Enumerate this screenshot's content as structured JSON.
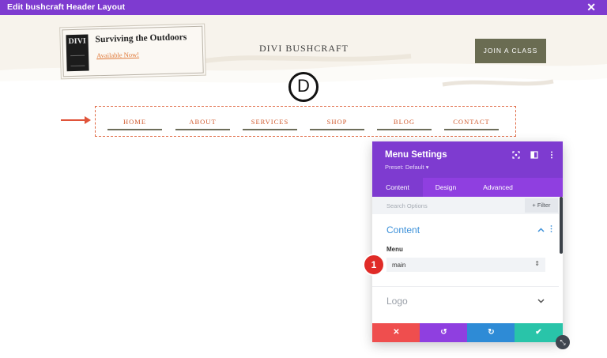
{
  "window": {
    "title": "Edit bushcraft Header Layout",
    "close_icon": "close-icon"
  },
  "header": {
    "card_title": "Surviving the Outdoors",
    "card_link": "Available Now!",
    "book_label": "DIVI",
    "brand": "DIVI BUSHCRAFT",
    "cta": "JOIN A CLASS",
    "divi_logo": "D"
  },
  "nav": {
    "items": [
      {
        "label": "HOME"
      },
      {
        "label": "ABOUT"
      },
      {
        "label": "SERVICES"
      },
      {
        "label": "SHOP"
      },
      {
        "label": "BLOG"
      },
      {
        "label": "CONTACT"
      }
    ]
  },
  "panel": {
    "title": "Menu Settings",
    "preset": "Preset: Default ▾",
    "tabs": [
      {
        "label": "Content",
        "active": true
      },
      {
        "label": "Design",
        "active": false
      },
      {
        "label": "Advanced",
        "active": false
      }
    ],
    "search_placeholder": "Search Options",
    "filter_label": "+ Filter",
    "section_content": "Content",
    "menu_label": "Menu",
    "menu_value": "main",
    "section_logo": "Logo",
    "step_badge": "1"
  },
  "colors": {
    "accent_purple": "#7e3bd0",
    "cancel_red": "#ef4e4e",
    "undo_purple": "#8f3fe0",
    "redo_blue": "#2e8bd6",
    "save_green": "#29c4a9",
    "nav_orange": "#d0592d"
  }
}
